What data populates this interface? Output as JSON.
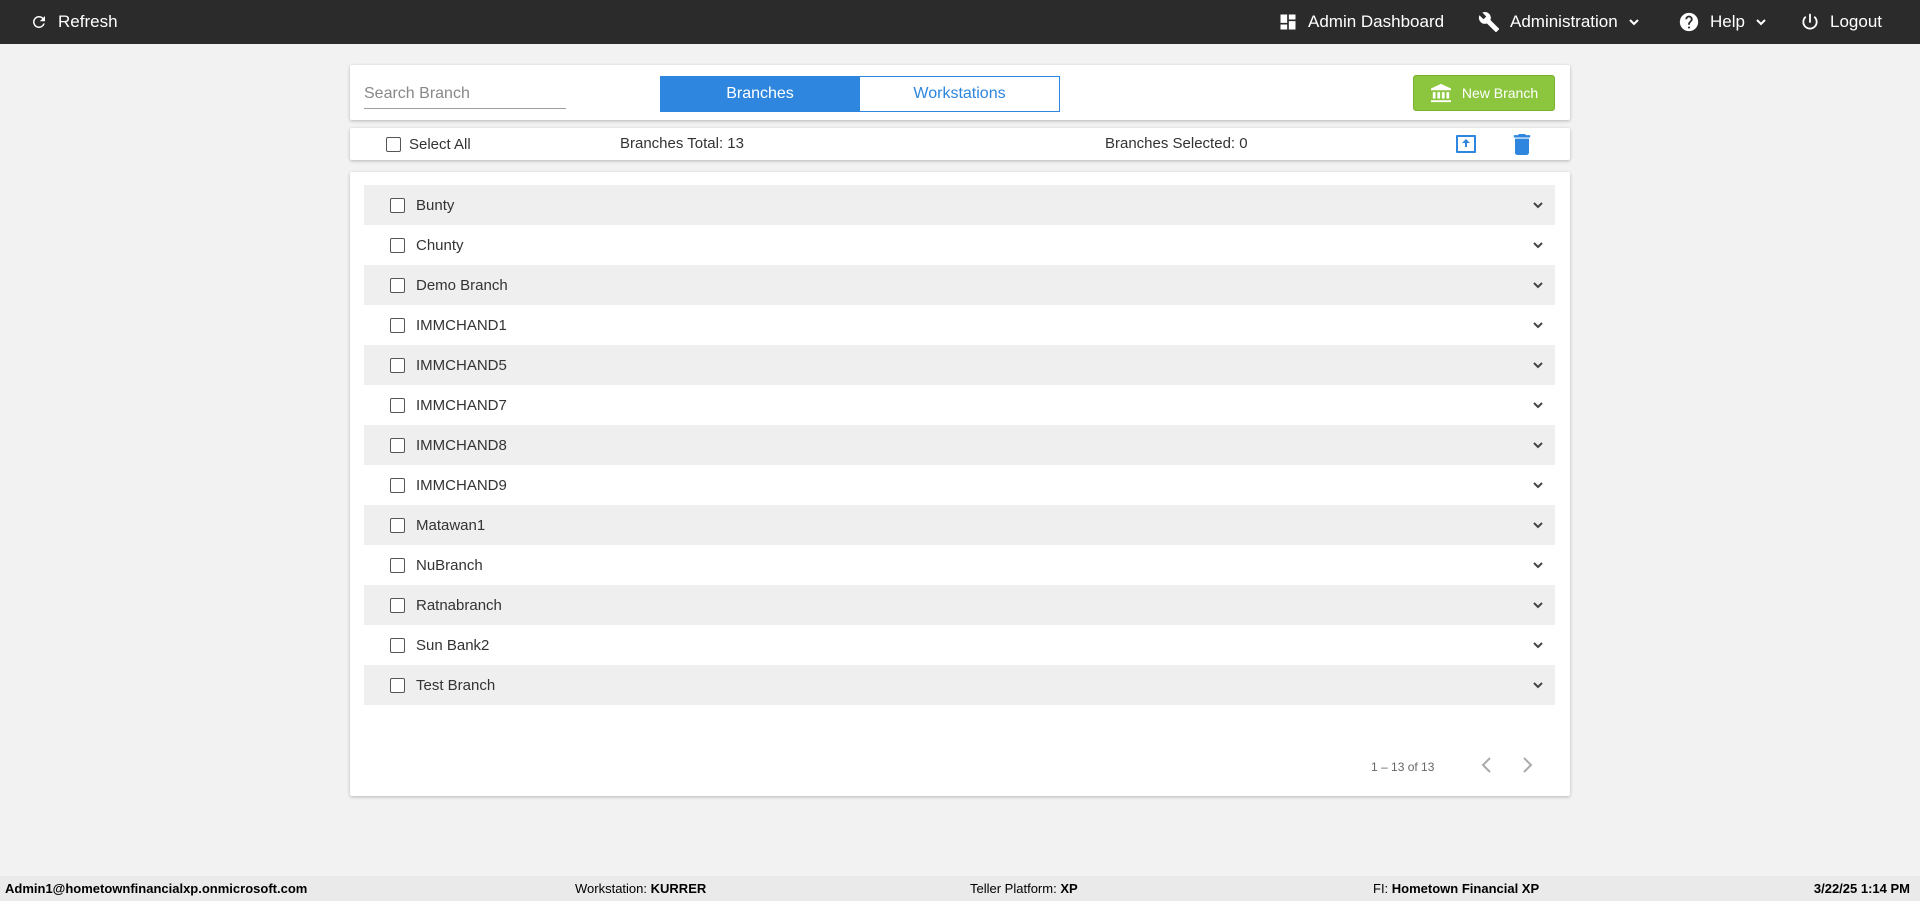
{
  "topbar": {
    "refresh": "Refresh",
    "dashboard": "Admin Dashboard",
    "administration": "Administration",
    "help": "Help",
    "logout": "Logout"
  },
  "search": {
    "placeholder": "Search Branch",
    "value": ""
  },
  "tabs": {
    "branches": "Branches",
    "workstations": "Workstations"
  },
  "new_branch": "New Branch",
  "selection": {
    "select_all": "Select All",
    "total": "Branches Total: 13",
    "selected": "Branches Selected: 0"
  },
  "branches": [
    "Bunty",
    "Chunty",
    "Demo Branch",
    "IMMCHAND1",
    "IMMCHAND5",
    "IMMCHAND7",
    "IMMCHAND8",
    "IMMCHAND9",
    "Matawan1",
    "NuBranch",
    "Ratnabranch",
    "Sun Bank2",
    "Test Branch"
  ],
  "pager": "1 – 13 of 13",
  "footer": {
    "user": "Admin1@hometownfinancialxp.onmicrosoft.com",
    "workstation_label": "Workstation:",
    "workstation": "KURRER",
    "platform_label": "Teller Platform:",
    "platform": "XP",
    "fi_label": "FI:",
    "fi": "Hometown Financial XP",
    "datetime": "3/22/25 1:14 PM"
  },
  "colors": {
    "accent": "#2e86de",
    "success": "#8cc63f",
    "topbar": "#2b2b2b"
  }
}
